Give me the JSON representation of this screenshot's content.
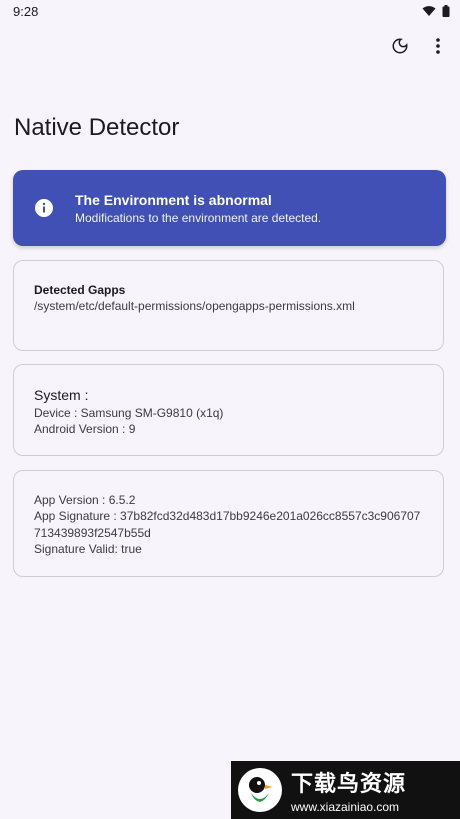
{
  "status_bar": {
    "time": "9:28"
  },
  "app": {
    "title": "Native Detector"
  },
  "alert": {
    "title": "The Environment is abnormal",
    "description": "Modifications to the environment are detected.",
    "color": "#4050b5"
  },
  "gapps_card": {
    "heading": "Detected Gapps",
    "path": "/system/etc/default-permissions/opengapps-permissions.xml"
  },
  "system_card": {
    "heading": "System :",
    "device": "Device : Samsung SM-G9810  (x1q)",
    "android_version": "Android Version : 9"
  },
  "app_card": {
    "version": "App Version : 6.5.2",
    "signature_line1": "App Signature : 37b82fcd32d483d17bb9246e201a026cc8557c3c906707",
    "signature_line2": "713439893f2547b55d",
    "signature_valid": "Signature Valid: true"
  },
  "watermark": {
    "title": "下载鸟资源",
    "url": "www.xiazainiao.com"
  },
  "icons": [
    "wifi-icon",
    "battery-icon",
    "dark-mode-icon",
    "more-vert-icon",
    "info-icon"
  ]
}
